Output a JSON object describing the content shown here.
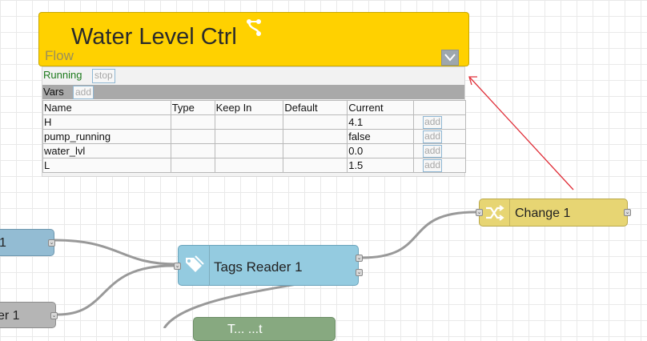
{
  "flow": {
    "title": "Water Level Ctrl",
    "type_label": "Flow",
    "status": "Running",
    "stop_label": "stop",
    "vars_label": "Vars",
    "add_label": "add",
    "toggle_icon": "chevron-down-icon",
    "branch_icon": "branch-icon",
    "columns": [
      "Name",
      "Type",
      "Keep In",
      "Default",
      "Current",
      ""
    ],
    "rows": [
      {
        "name": "H",
        "type": "",
        "keep_in": "",
        "default": "",
        "current": "4.1",
        "action": "add"
      },
      {
        "name": "pump_running",
        "type": "",
        "keep_in": "",
        "default": "",
        "current": "false",
        "action": "add"
      },
      {
        "name": "water_lvl",
        "type": "",
        "keep_in": "",
        "default": "",
        "current": "0.0",
        "action": "add"
      },
      {
        "name": "L",
        "type": "",
        "keep_in": "",
        "default": "",
        "current": "1.5",
        "action": "add"
      }
    ]
  },
  "nodes": {
    "left_top": {
      "label": "1"
    },
    "left_bottom": {
      "label": "er 1"
    },
    "tags_reader": {
      "label": "Tags Reader 1",
      "icon": "tag-icon"
    },
    "change": {
      "label": "Change 1",
      "icon": "shuffle-icon"
    },
    "bottom_partial": {
      "label": "T... ...t"
    }
  },
  "colors": {
    "flow_bg": "#ffd100",
    "tags_reader_bg": "#94cbe0",
    "change_bg": "#e7d573",
    "left_top_bg": "#93bcd3",
    "left_bottom_bg": "#b5b5b5",
    "wire": "#999999",
    "link_arrow": "#e0303a"
  }
}
